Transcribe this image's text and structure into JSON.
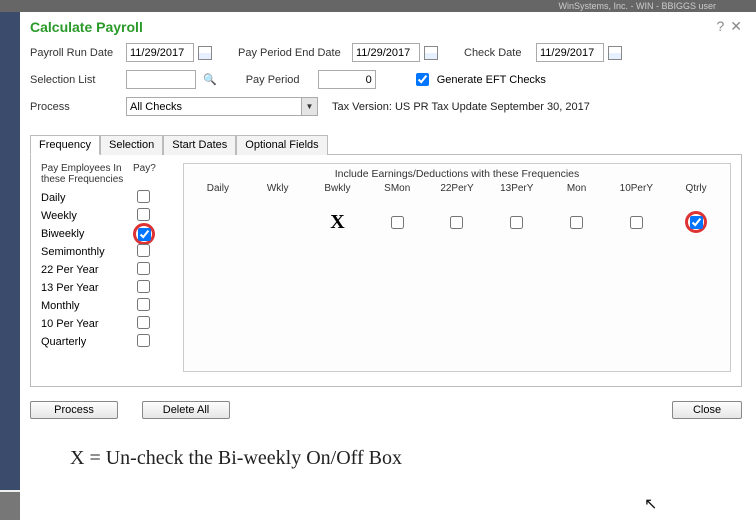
{
  "topbar": "WinSystems, Inc. - WIN - BBIGGS user",
  "window": {
    "title": "Calculate Payroll"
  },
  "form": {
    "payrollRunDate": {
      "label": "Payroll Run Date",
      "value": "11/29/2017"
    },
    "payPeriodEndDate": {
      "label": "Pay Period End Date",
      "value": "11/29/2017"
    },
    "checkDate": {
      "label": "Check Date",
      "value": "11/29/2017"
    },
    "selectionList": {
      "label": "Selection List",
      "value": ""
    },
    "payPeriod": {
      "label": "Pay Period",
      "value": "0"
    },
    "generateEFT": {
      "label": "Generate EFT Checks"
    },
    "process": {
      "label": "Process",
      "selected": "All Checks"
    },
    "taxVersion": {
      "label": "Tax Version:",
      "value": "US PR Tax Update September 30, 2017"
    }
  },
  "tabs": {
    "frequency": "Frequency",
    "selection": "Selection",
    "startDates": "Start Dates",
    "optionalFields": "Optional Fields"
  },
  "frequencyPanel": {
    "leftHeader1": "Pay Employees In these Frequencies",
    "leftHeader2": "Pay?",
    "rows": [
      {
        "label": "Daily",
        "pay": false
      },
      {
        "label": "Weekly",
        "pay": false
      },
      {
        "label": "Biweekly",
        "pay": true
      },
      {
        "label": "Semimonthly",
        "pay": false
      },
      {
        "label": "22 Per Year",
        "pay": false
      },
      {
        "label": "13 Per Year",
        "pay": false
      },
      {
        "label": "Monthly",
        "pay": false
      },
      {
        "label": "10 Per Year",
        "pay": false
      },
      {
        "label": "Quarterly",
        "pay": false
      }
    ],
    "includeTitle": "Include Earnings/Deductions with these Frequencies",
    "includeHeaders": [
      "Daily",
      "Wkly",
      "Bwkly",
      "SMon",
      "22PerY",
      "13PerY",
      "Mon",
      "10PerY",
      "Qtrly"
    ],
    "biweeklyInclude": {
      "bwkly_marker": "X",
      "smon": false,
      "p22": false,
      "p13": false,
      "mon": false,
      "p10": false,
      "qtrly": true
    }
  },
  "buttons": {
    "process": "Process",
    "deleteAll": "Delete All",
    "close": "Close"
  },
  "footnote": "X = Un-check  the Bi-weekly On/Off Box"
}
